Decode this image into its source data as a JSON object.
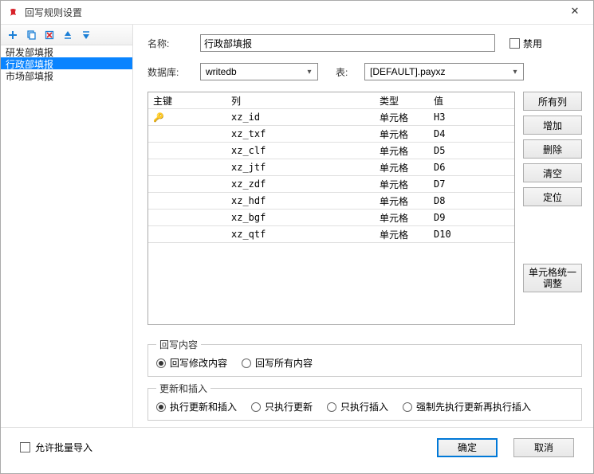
{
  "window": {
    "title": "回写规则设置"
  },
  "toolbar_icons": [
    "add-icon",
    "copy-icon",
    "delete-icon",
    "move-up-icon",
    "move-down-icon"
  ],
  "sidebar": {
    "items": [
      {
        "label": "研发部填报",
        "selected": false
      },
      {
        "label": "行政部填报",
        "selected": true
      },
      {
        "label": "市场部填报",
        "selected": false
      }
    ]
  },
  "form": {
    "name_label": "名称:",
    "name_value": "行政部填报",
    "disable_label": "禁用",
    "db_label": "数据库:",
    "db_value": "writedb",
    "table_label": "表:",
    "table_value": "[DEFAULT].payxz"
  },
  "grid": {
    "headers": {
      "pk": "主键",
      "col": "列",
      "type": "类型",
      "val": "值"
    },
    "rows": [
      {
        "pk_icon": true,
        "col": "xz_id",
        "type": "单元格",
        "val": "H3"
      },
      {
        "col": "xz_txf",
        "type": "单元格",
        "val": "D4"
      },
      {
        "col": "xz_clf",
        "type": "单元格",
        "val": "D5"
      },
      {
        "col": "xz_jtf",
        "type": "单元格",
        "val": "D6"
      },
      {
        "col": "xz_zdf",
        "type": "单元格",
        "val": "D7"
      },
      {
        "col": "xz_hdf",
        "type": "单元格",
        "val": "D8"
      },
      {
        "col": "xz_bgf",
        "type": "单元格",
        "val": "D9"
      },
      {
        "col": "xz_qtf",
        "type": "单元格",
        "val": "D10"
      }
    ]
  },
  "side_buttons": {
    "all_cols": "所有列",
    "add": "增加",
    "del": "删除",
    "clear": "清空",
    "locate": "定位",
    "uniform": "单元格统一\n调整"
  },
  "writeback": {
    "legend": "回写内容",
    "opt_modified": "回写修改内容",
    "opt_all": "回写所有内容"
  },
  "updateinsert": {
    "legend": "更新和插入",
    "opt_both": "执行更新和插入",
    "opt_update": "只执行更新",
    "opt_insert": "只执行插入",
    "opt_force": "强制先执行更新再执行插入"
  },
  "footer": {
    "allow_bulk": "允许批量导入",
    "ok": "确定",
    "cancel": "取消"
  }
}
